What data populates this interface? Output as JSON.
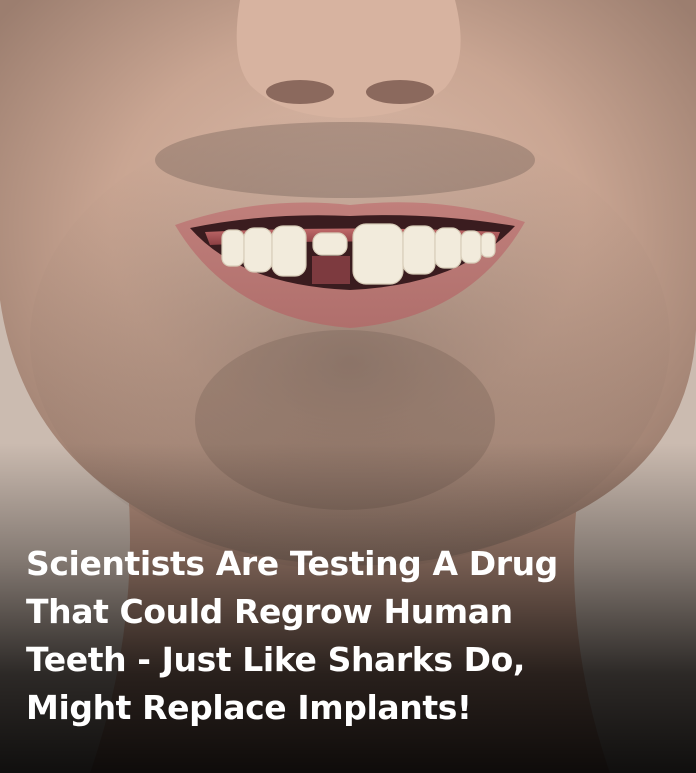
{
  "photo": {
    "subject": "smiling-mouth-with-missing-tooth",
    "skin_color": "#d9b8a6",
    "stubble_color": "#5b4c44",
    "lip_color": "#c98a86",
    "tooth_color": "#f1eadb"
  },
  "headline": {
    "lines": [
      "Scientists Are Testing A Drug",
      "That Could Regrow Human",
      "Teeth - Just Like Sharks Do,",
      "Might Replace Implants!"
    ]
  }
}
